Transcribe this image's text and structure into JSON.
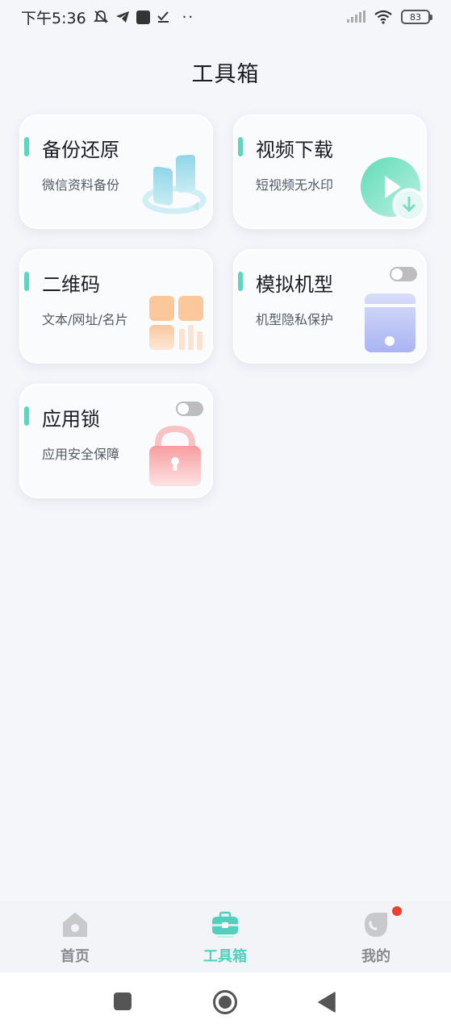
{
  "status_bar": {
    "time": "下午5:36",
    "battery": "83"
  },
  "page": {
    "title": "工具箱"
  },
  "tools": [
    {
      "title": "备份还原",
      "subtitle": "微信资料备份",
      "icon": "backup-restore-icon",
      "has_toggle": false
    },
    {
      "title": "视频下载",
      "subtitle": "短视频无水印",
      "icon": "video-download-icon",
      "has_toggle": false
    },
    {
      "title": "二维码",
      "subtitle": "文本/网址/名片",
      "icon": "qr-code-icon",
      "has_toggle": false
    },
    {
      "title": "模拟机型",
      "subtitle": "机型隐私保护",
      "icon": "phone-model-icon",
      "has_toggle": true,
      "toggle_on": false
    },
    {
      "title": "应用锁",
      "subtitle": "应用安全保障",
      "icon": "lock-icon",
      "has_toggle": true,
      "toggle_on": false
    }
  ],
  "bottom_nav": {
    "items": [
      {
        "label": "首页",
        "icon": "home-icon",
        "active": false
      },
      {
        "label": "工具箱",
        "icon": "toolbox-icon",
        "active": true
      },
      {
        "label": "我的",
        "icon": "profile-icon",
        "active": false,
        "badge": true
      }
    ]
  },
  "colors": {
    "accent": "#5dd6c0",
    "background": "#f5f6fa",
    "badge": "#ee3f2c"
  }
}
